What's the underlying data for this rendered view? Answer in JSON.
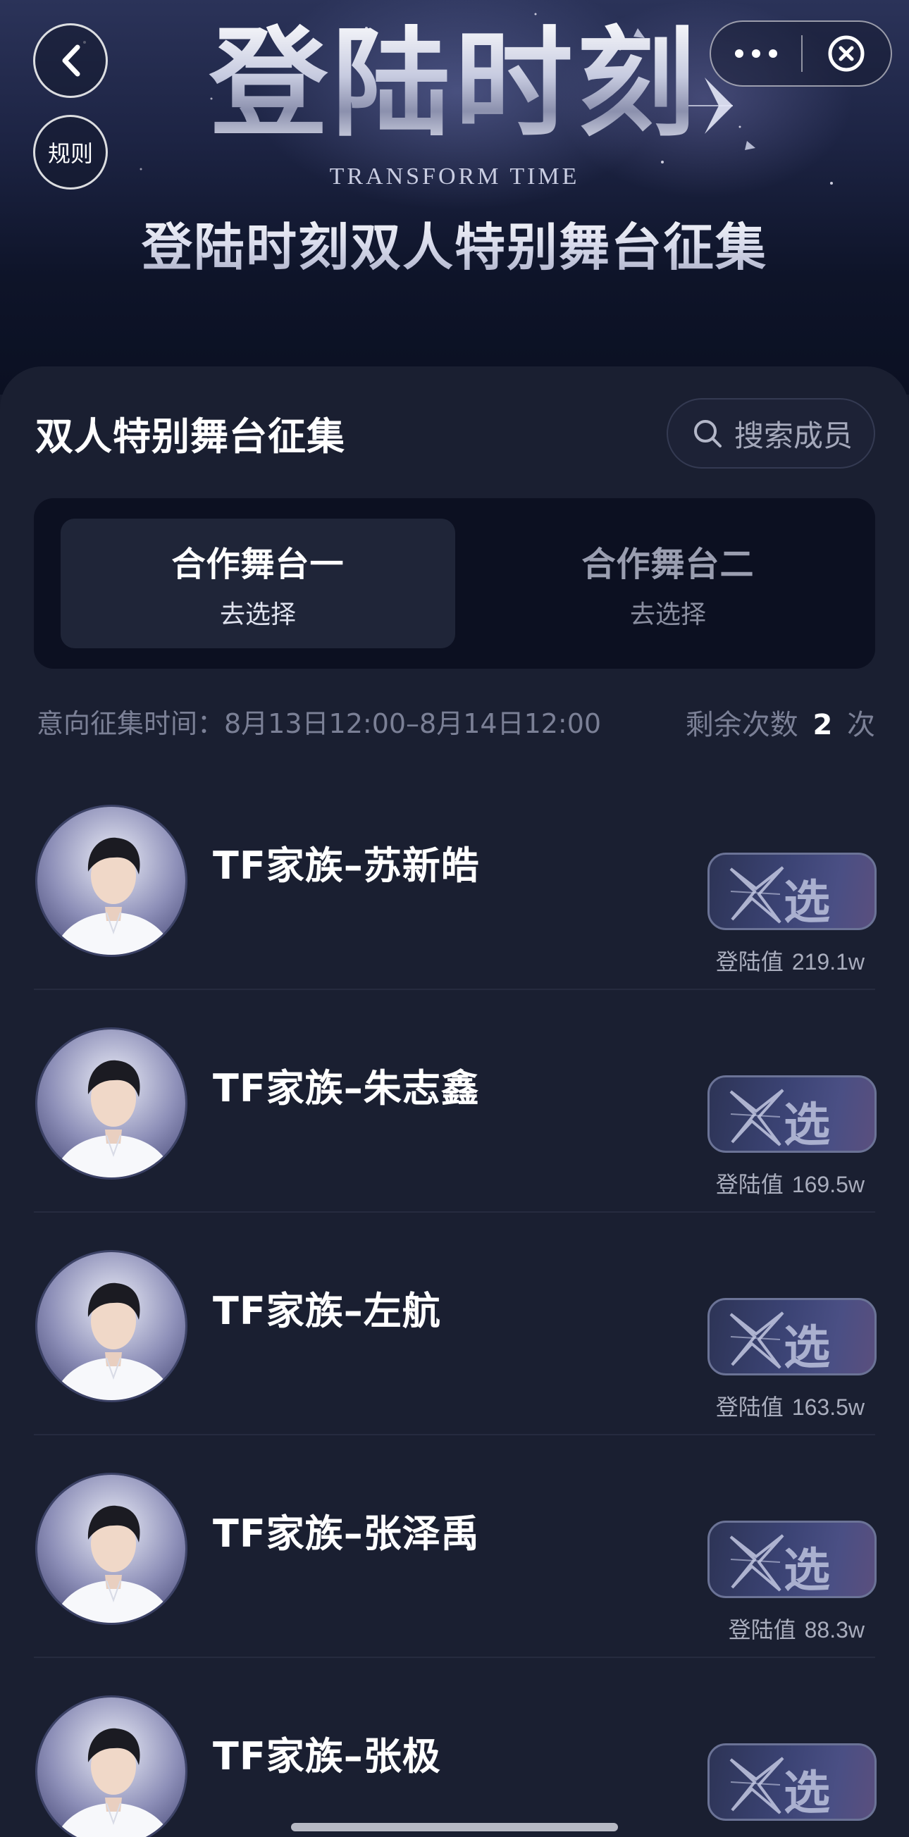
{
  "header": {
    "logo_title": "登陆时刻",
    "logo_subtitle": "TRANSFORM TIME",
    "banner_title": "登陆时刻双人特别舞台征集",
    "rules_label": "规则"
  },
  "panel": {
    "section_title": "双人特别舞台征集",
    "search_placeholder": "搜索成员",
    "tabs": [
      {
        "title": "合作舞台一",
        "action": "去选择",
        "active": true
      },
      {
        "title": "合作舞台二",
        "action": "去选择",
        "active": false
      }
    ],
    "period_text": "意向征集时间：8月13日12:00–8月14日12:00",
    "remaining_label": "剩余次数",
    "remaining_count": "2",
    "remaining_unit": "次"
  },
  "members": [
    {
      "name": "TF家族–苏新皓",
      "value_label": "登陆值",
      "value": "219.1w",
      "button_label": "选他"
    },
    {
      "name": "TF家族–朱志鑫",
      "value_label": "登陆值",
      "value": "169.5w",
      "button_label": "选他"
    },
    {
      "name": "TF家族–左航",
      "value_label": "登陆值",
      "value": "163.5w",
      "button_label": "选他"
    },
    {
      "name": "TF家族–张泽禹",
      "value_label": "登陆值",
      "value": "88.3w",
      "button_label": "选他"
    },
    {
      "name": "TF家族–张极",
      "value_label": "登陆值",
      "value": "",
      "button_label": "选他"
    }
  ],
  "colors": {
    "background": "#161b2d",
    "panel": "#1a1f31",
    "tab_active": "#1f2538",
    "tab_container": "#0c1021",
    "muted_text": "#7b8096"
  }
}
